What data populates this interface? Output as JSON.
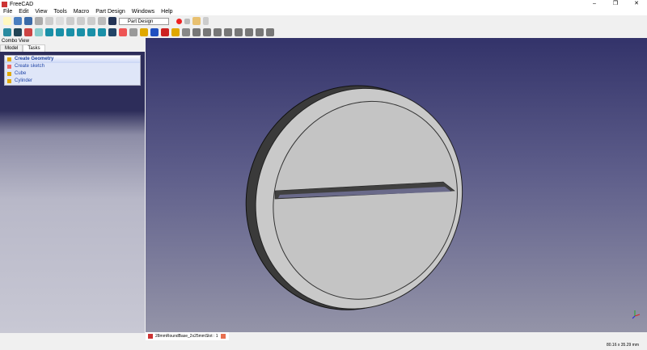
{
  "window": {
    "title": "FreeCAD",
    "controls": [
      "–",
      "❐",
      "✕"
    ]
  },
  "menu": [
    "File",
    "Edit",
    "View",
    "Tools",
    "Macro",
    "Part Design",
    "Windows",
    "Help"
  ],
  "toolbar": {
    "workbench": "Part Design"
  },
  "combo": {
    "title": "Combo View",
    "tabs": [
      "Model",
      "Tasks"
    ],
    "task_header": "Create Geometry",
    "items": [
      "Create sketch",
      "Cube",
      "Cylinder"
    ]
  },
  "document_tab": "28mmRoundBase_2x25mmSlot : 1",
  "status": {
    "dimensions": "80.16 x 35.29 mm"
  },
  "colors": {
    "viewport_top": "#33336a",
    "viewport_bottom": "#9494a8",
    "accent": "#2146a8"
  }
}
